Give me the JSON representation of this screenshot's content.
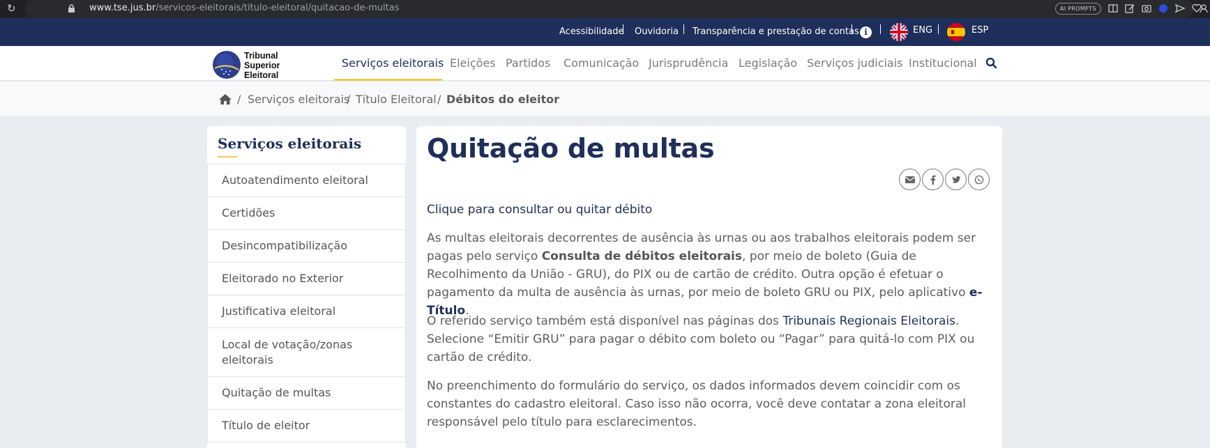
{
  "browser": {
    "url_domain": "www.tse.jus.br",
    "url_path": "/servicos-eleitorais/titulo-eleitoral/quitacao-de-multas",
    "ai_prompts": "AI PROMPTS"
  },
  "utility": {
    "links": [
      "Acessibilidade",
      "Ouvidoria",
      "Transparência e prestação de contas"
    ],
    "lang_en": "ENG",
    "lang_es": "ESP"
  },
  "logo": {
    "line1": "Tribunal",
    "line2": "Superior",
    "line3": "Eleitoral"
  },
  "nav": {
    "items": [
      "Serviços eleitorais",
      "Eleições",
      "Partidos",
      "Comunicação",
      "Jurisprudência",
      "Legislação",
      "Serviços judiciais",
      "Institucional"
    ]
  },
  "breadcrumb": {
    "items": [
      "Serviços eleitorais",
      "Título Eleitoral",
      "Débitos do eleitor"
    ]
  },
  "sidebar": {
    "title": "Serviços eleitorais",
    "items": [
      "Autoatendimento eleitoral",
      "Certidões",
      "Desincompatibilização",
      "Eleitorado no Exterior",
      "Justificativa eleitoral",
      "Local de votação/zonas eleitorais",
      "Quitação de multas",
      "Título de eleitor"
    ]
  },
  "content": {
    "title": "Quitação de multas",
    "cta": "Clique para consultar ou quitar débito",
    "p1_a": "As multas eleitorais decorrentes de ausência às urnas ou aos trabalhos eleitorais podem ser pagas pelo serviço ",
    "p1_b": "Consulta de débitos eleitorais",
    "p1_c": ", por meio de boleto (Guia de Recolhimento da União - GRU), do PIX ou de cartão de crédito. Outra opção é efetuar o pagamento da multa de ausência às urnas, por meio de boleto GRU ou PIX, pelo aplicativo ",
    "p1_d": "e-Título",
    "p1_e": ".",
    "p2_a": "O referido serviço também está disponível nas páginas dos ",
    "p2_b": "Tribunais Regionais Eleitorais",
    "p2_c": ". Selecione “Emitir GRU” para pagar o débito com boleto ou “Pagar” para quitá-lo com PIX ou cartão de crédito.",
    "p3": "No preenchimento do formulário do serviço, os dados informados devem coincidir com os constantes do cadastro eleitoral. Caso isso não ocorra, você deve contatar a zona eleitoral responsável pelo título para esclarecimentos."
  },
  "colors": {
    "navy": "#1d2f5a",
    "accent": "#f2c94c"
  }
}
